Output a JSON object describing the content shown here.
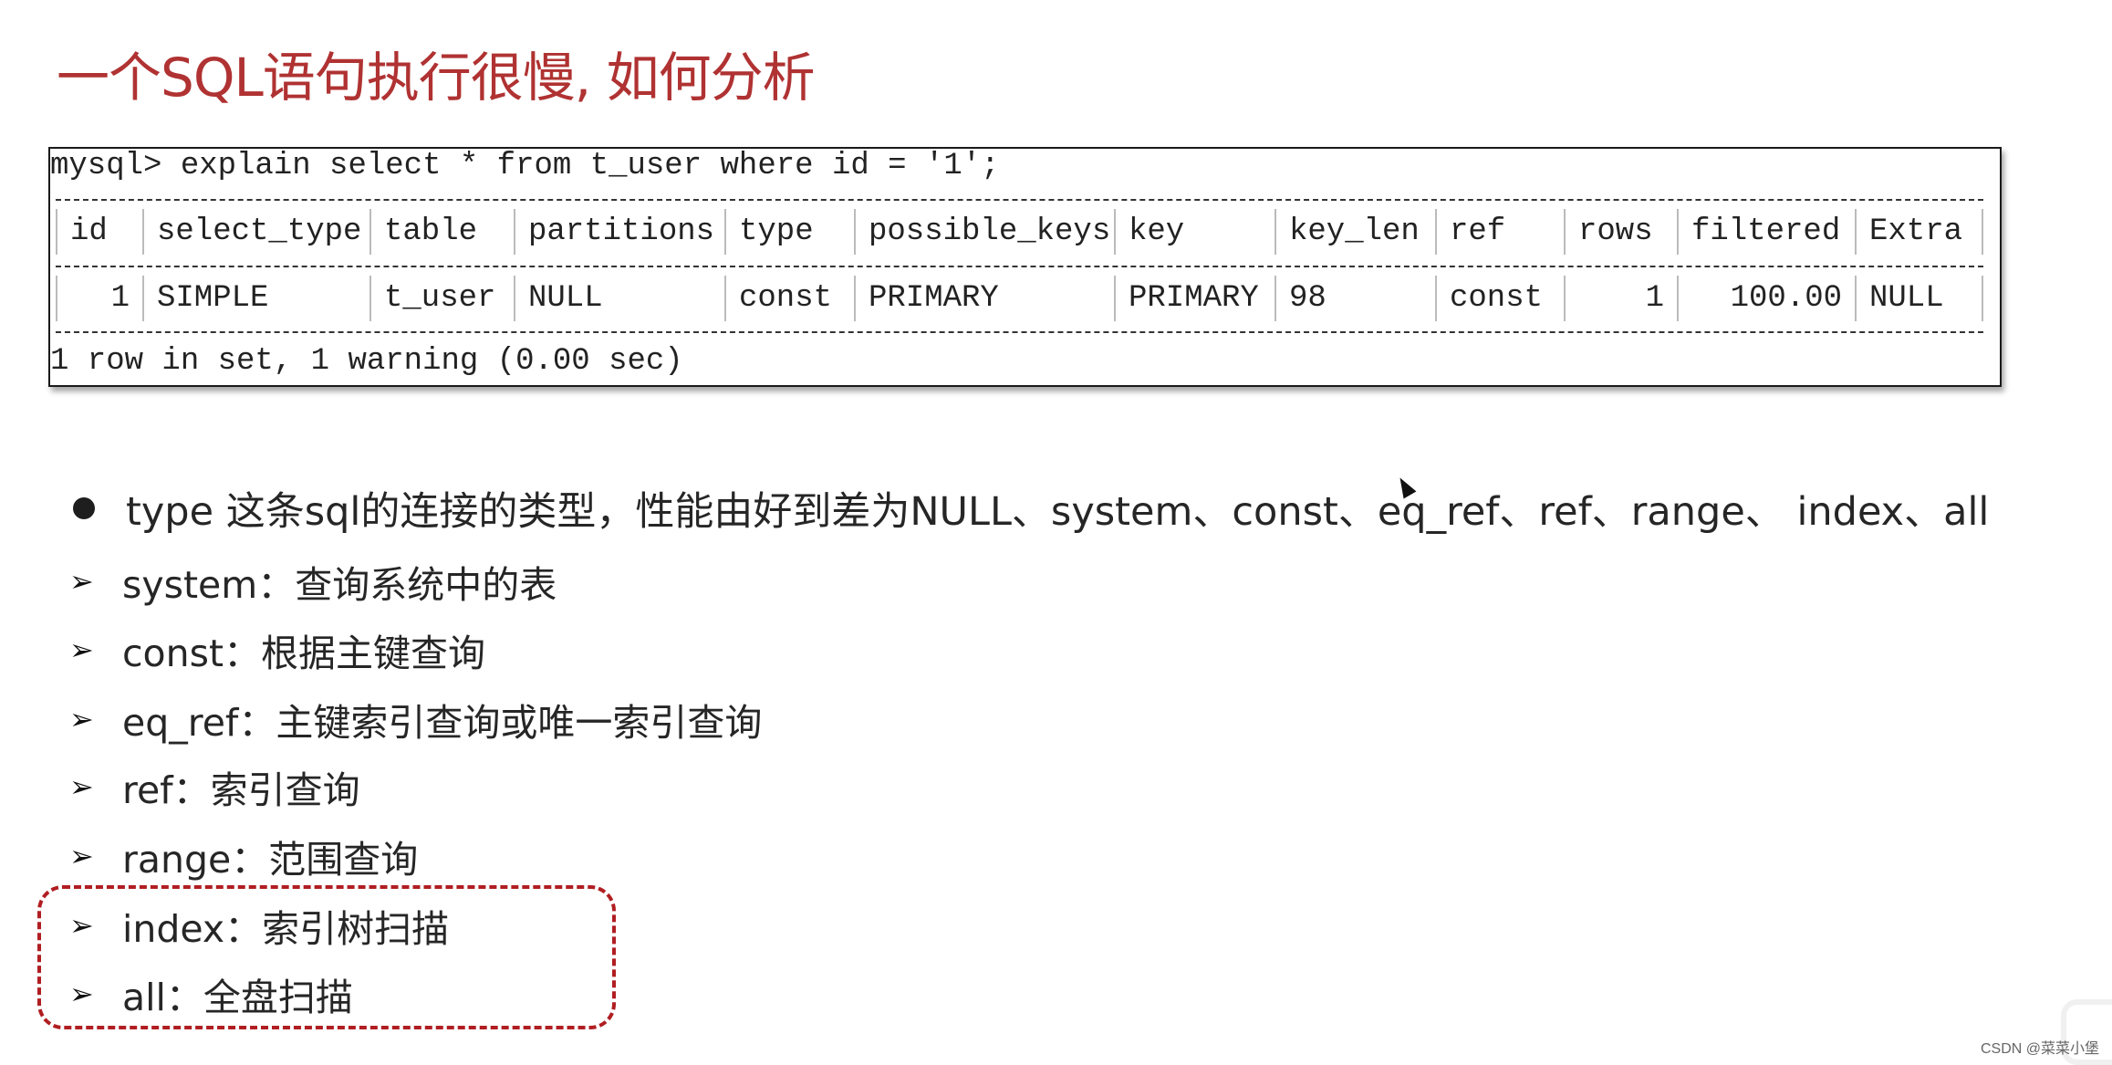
{
  "slide": {
    "title": "一个SQL语句执行很慢, 如何分析"
  },
  "terminal": {
    "command": "mysql> explain select * from t_user where id = '1';",
    "columns": [
      "id",
      "select_type",
      "table",
      "partitions",
      "type",
      "possible_keys",
      "key",
      "key_len",
      "ref",
      "rows",
      "filtered",
      "Extra"
    ],
    "rows": [
      [
        "1",
        "SIMPLE",
        "t_user",
        "NULL",
        "const",
        "PRIMARY",
        "PRIMARY",
        "98",
        "const",
        "1",
        "100.00",
        "NULL"
      ]
    ],
    "status": "1 row in set, 1 warning (0.00 sec)"
  },
  "bullets": [
    {
      "marker": "dot",
      "text": "type 这条sql的连接的类型，性能由好到差为NULL、system、const、eq_ref、ref、range、 index、all"
    },
    {
      "marker": "arrow",
      "text": "system：查询系统中的表"
    },
    {
      "marker": "arrow",
      "text": "const：根据主键查询"
    },
    {
      "marker": "arrow",
      "text": "eq_ref：主键索引查询或唯一索引查询"
    },
    {
      "marker": "arrow",
      "text": "ref：索引查询"
    },
    {
      "marker": "arrow",
      "text": "range：范围查询"
    },
    {
      "marker": "arrow",
      "text": "index：索引树扫描"
    },
    {
      "marker": "arrow",
      "text": "all：全盘扫描"
    }
  ],
  "highlight": {
    "items": [
      "index",
      "all"
    ],
    "color": "#b01e22"
  },
  "icons": {
    "arrow_marker": "➢",
    "cursor": "mouse-pointer-icon"
  },
  "colors": {
    "title": "#b03232",
    "highlight_border": "#b01e22"
  },
  "watermark": "CSDN @菜菜小堡"
}
